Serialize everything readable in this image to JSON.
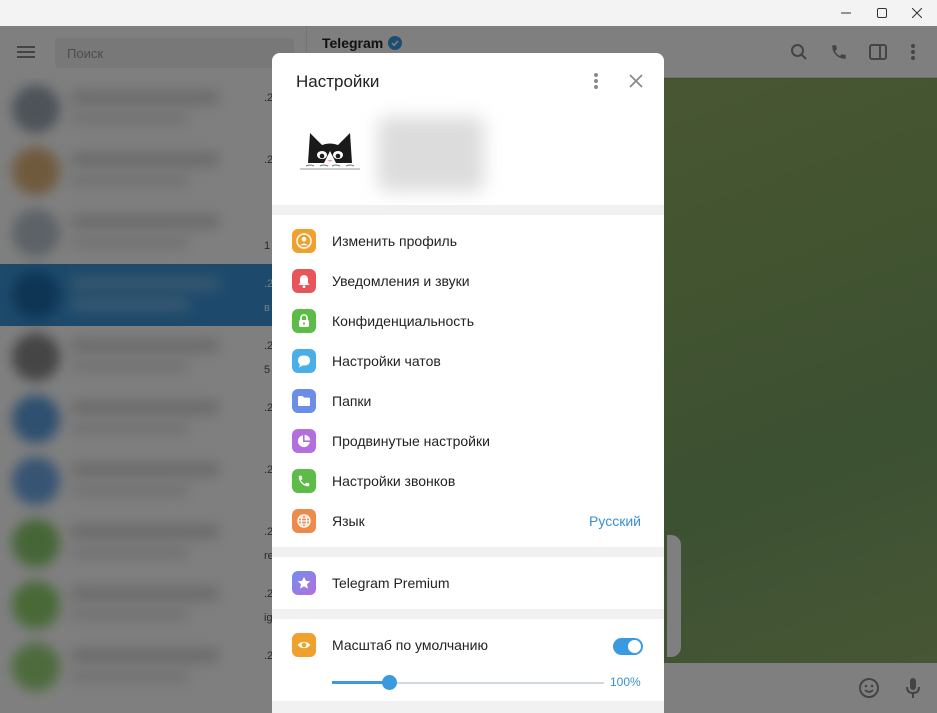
{
  "app": {
    "search_placeholder": "Поиск",
    "chat_title": "Telegram",
    "chat_list_times": [
      ".2",
      ".2",
      "",
      ".2",
      ".2",
      ".2",
      ".2",
      ".2",
      ".2",
      ".2"
    ],
    "chat_list_subs": [
      "",
      "",
      "1",
      "в",
      "5",
      "",
      "",
      "re",
      "ig",
      ""
    ]
  },
  "settings": {
    "title": "Настройки",
    "items": [
      {
        "label": "Изменить профиль",
        "icon": "person-icon",
        "color": "#f0a02d"
      },
      {
        "label": "Уведомления и звуки",
        "icon": "bell-icon",
        "color": "#e8545a"
      },
      {
        "label": "Конфиденциальность",
        "icon": "lock-icon",
        "color": "#5cbc47"
      },
      {
        "label": "Настройки чатов",
        "icon": "chat-bubble-icon",
        "color": "#4aaee8"
      },
      {
        "label": "Папки",
        "icon": "folder-icon",
        "color": "#6c8ee8"
      },
      {
        "label": "Продвинутые настройки",
        "icon": "pie-chart-icon",
        "color": "#b46fdc"
      },
      {
        "label": "Настройки звонков",
        "icon": "phone-icon",
        "color": "#5cbc47"
      },
      {
        "label": "Язык",
        "icon": "globe-icon",
        "color": "#ee8a4c",
        "value": "Русский"
      }
    ],
    "premium_label": "Telegram Premium",
    "premium_color": "#8a6ee8",
    "scale_label": "Масштаб по умолчанию",
    "scale_color": "#f0a02d",
    "scale_enabled": true,
    "scale_value": "100%",
    "scale_fraction": 0.21
  },
  "colors": {
    "accent": "#3a9ae0",
    "link": "#3a8fd0"
  }
}
